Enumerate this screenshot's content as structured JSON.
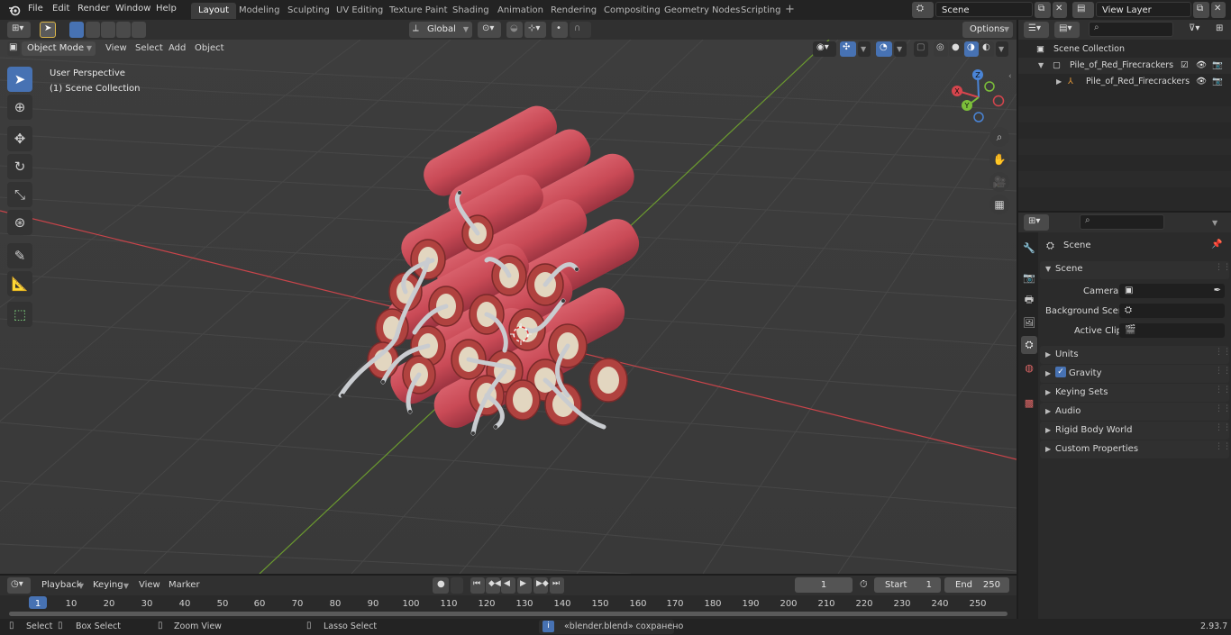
{
  "menubar": {
    "menus": [
      "File",
      "Edit",
      "Render",
      "Window",
      "Help"
    ],
    "workspaces": [
      "Layout",
      "Modeling",
      "Sculpting",
      "UV Editing",
      "Texture Paint",
      "Shading",
      "Animation",
      "Rendering",
      "Compositing",
      "Geometry Nodes",
      "Scripting"
    ],
    "active_workspace": "Layout",
    "add_workspace": "+",
    "scene": "Scene",
    "view_layer": "View Layer"
  },
  "tool_header": {
    "transform_orientation": "Global",
    "options_label": "Options"
  },
  "viewport_header": {
    "mode": "Object Mode",
    "menus": [
      "View",
      "Select",
      "Add",
      "Object"
    ]
  },
  "viewport": {
    "overlay_line1": "User Perspective",
    "overlay_line2": "(1) Scene Collection",
    "gizmo_axes": {
      "x": "X",
      "y": "Y",
      "z": "Z"
    }
  },
  "outliner": {
    "search_placeholder": "",
    "root": "Scene Collection",
    "collection": "Pile_of_Red_Firecrackers",
    "object": "Pile_of_Red_Firecrackers"
  },
  "properties": {
    "title": "Scene",
    "panel_scene": "Scene",
    "camera_label": "Camera",
    "background_scene_label": "Background Scene",
    "active_clip_label": "Active Clip",
    "panels": [
      "Units",
      "Gravity",
      "Keying Sets",
      "Audio",
      "Rigid Body World",
      "Custom Properties"
    ],
    "gravity_checked": true
  },
  "timeline": {
    "menus": [
      "Playback",
      "Keying",
      "View",
      "Marker"
    ],
    "current_frame": "1",
    "start_label": "Start",
    "start": "1",
    "end_label": "End",
    "end": "250",
    "ruler": [
      "1",
      "10",
      "20",
      "30",
      "40",
      "50",
      "60",
      "70",
      "80",
      "90",
      "100",
      "110",
      "120",
      "130",
      "140",
      "150",
      "160",
      "170",
      "180",
      "190",
      "200",
      "210",
      "220",
      "230",
      "240",
      "250"
    ]
  },
  "statusbar": {
    "select": "Select",
    "box_select": "Box Select",
    "zoom_view": "Zoom View",
    "lasso_select": "Lasso Select",
    "message": "«blender.blend» сохранено",
    "version": "2.93.7"
  },
  "colors": {
    "accent": "#4772b3",
    "viewport_bg": "#3c3c3c",
    "axis_x": "#c8444a",
    "axis_y": "#6b9a2f",
    "firecracker": "#c94a56"
  }
}
